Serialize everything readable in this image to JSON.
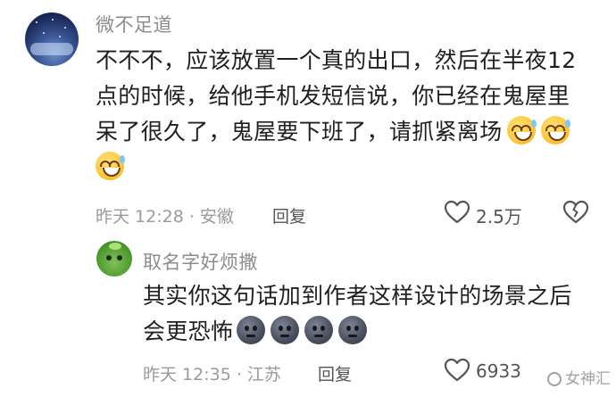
{
  "comment": {
    "username": "微不足道",
    "lines": [
      "不不不，应该放置一个真的出口，然后在半夜12",
      "点的时候，给他手机发短信说，你已经在鬼屋里",
      "呆了很久了，鬼屋要下班了，请抓紧离场"
    ],
    "emoji_icon": "grinning-sweat-emoji",
    "time": "昨天 12:28 · 安徽",
    "reply_label": "回复",
    "like_count": "2.5万"
  },
  "reply": {
    "username": "取名字好烦撒",
    "lines": [
      "其实你这句话加到作者这样设计的场景之后",
      "会更恐怖"
    ],
    "emoji_icon": "dark-face-emoji",
    "time": "昨天 12:35 · 江苏",
    "reply_label": "回复",
    "like_count": "6933"
  },
  "watermark": "女神汇",
  "icons": {
    "like": "heart-icon",
    "dislike": "broken-heart-icon"
  }
}
